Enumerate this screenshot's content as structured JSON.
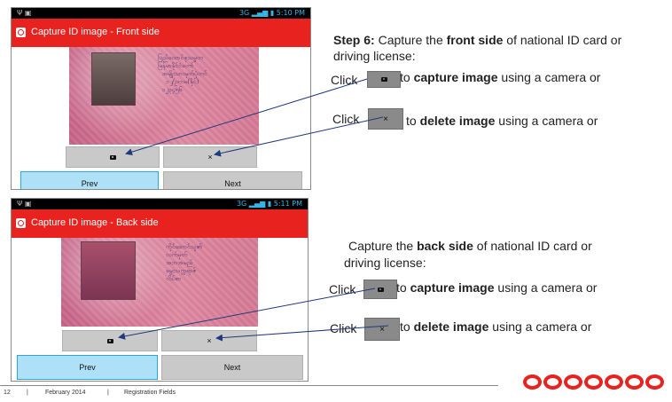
{
  "screens": [
    {
      "status": {
        "network": "3G",
        "time": "5:10 PM"
      },
      "title": "Capture ID image - Front side",
      "buttons": {
        "camera_label": "",
        "delete_label": "×",
        "prev_label": "Prev",
        "next_label": "Next"
      }
    },
    {
      "status": {
        "network": "3G",
        "time": "5:11 PM"
      },
      "title": "Capture ID image - Back side",
      "buttons": {
        "camera_label": "",
        "delete_label": "×",
        "prev_label": "Prev",
        "next_label": "Next"
      }
    }
  ],
  "instructions": {
    "front": {
      "step_label": "Step 6:",
      "line1_a": " Capture the ",
      "line1_b": "front side",
      "line1_c": " of national ID card or",
      "line2": "driving license:",
      "click1": "Click",
      "capture_a": " to ",
      "capture_b": "capture image",
      "capture_c": " using a camera or",
      "click2": "Click",
      "delete_a": " to ",
      "delete_b": "delete image",
      "delete_c": " using a camera or",
      "chip_delete": "×"
    },
    "back": {
      "line1_a": "Capture the ",
      "line1_b": "back side",
      "line1_c": " of national ID card or",
      "line2": "driving license:",
      "click1": "Click",
      "capture_a": " to ",
      "capture_b": "capture image",
      "capture_c": " using a camera or",
      "click2": "Click",
      "delete_a": " to ",
      "delete_b": "delete image",
      "delete_c": " using a camera or",
      "chip_delete": "×"
    }
  },
  "footer": {
    "page": "12",
    "sep": "|",
    "date": "February 2014",
    "section": "Registration Fields"
  },
  "brand": {
    "name": "ooredoo",
    "color": "#e8231f"
  },
  "colors": {
    "appbar": "#e8231f",
    "prev_button": "#aee0f7",
    "button": "#c9c9c9"
  },
  "icons": [
    "camera-icon",
    "close-icon",
    "app-logo-icon",
    "signal-icon",
    "battery-icon"
  ]
}
